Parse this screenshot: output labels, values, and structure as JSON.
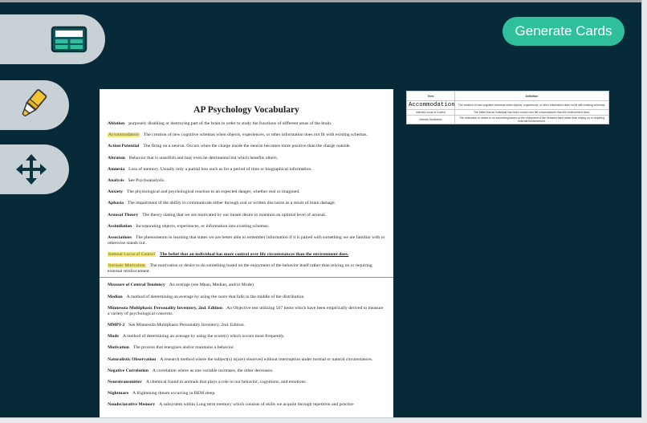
{
  "toolbar": {
    "tools": [
      {
        "name": "table-view",
        "icon": "table-icon"
      },
      {
        "name": "highlighter",
        "icon": "highlighter-icon"
      },
      {
        "name": "move",
        "icon": "move-arrows-icon"
      }
    ]
  },
  "generate_button_label": "Generate Cards",
  "document": {
    "title": "AP Psychology Vocabulary",
    "entries": [
      {
        "term": "Ablation",
        "def": "purposely disabling or destroying part of the brain in order to study the functions of different areas of the brain."
      },
      {
        "term": "Accommodation",
        "def": "The creation of new cognitive schemas when objects, experiences, or other information does not fit with existing schemas.",
        "highlight": true
      },
      {
        "term": "Action Potential",
        "def": "The firing on a neuron.  Occurs when the charge inside the neuron becomes more positive than the charge outside."
      },
      {
        "term": "Altruism",
        "def": "Behavior that is unselfish and may even be detrimental but which benefits others."
      },
      {
        "term": "Amnesia",
        "def": "Loss of memory.  Usually only a partial loss such as for a period of time or biographical information."
      },
      {
        "term": "Analysis",
        "def": "See Psychoanalysis."
      },
      {
        "term": "Anxiety",
        "def": "The physiological and psychological reaction to an expected danger, whether real or imagined."
      },
      {
        "term": "Aphasia",
        "def": "The impairment of the ability to communicate either through oral or written discourse as a result of brain damage."
      },
      {
        "term": "Arousal Theory",
        "def": "The theory stating that we are motivated by our innate desire to maintain an optimal level of arousal."
      },
      {
        "term": "Assimilation",
        "def": "Incorporating objects, experiences, or information into existing schemas."
      },
      {
        "term": "Associations",
        "def": "The phenomenon in learning that states we are better able to remember information if it is paired with something we are familiar with or otherwise stands out."
      },
      {
        "term": "Internal Locus of Control",
        "def": "The belief that an individual has more control over life circumstances than the environment does.",
        "highlight": true,
        "underline": true
      },
      {
        "term": "Intrinsic Motivation",
        "def": "The motivation or desire to do something based on the enjoyment of the behavior itself rather than relying on or requiring external reinforcement.",
        "highlight": true,
        "separator_after": true
      },
      {
        "term": "Measure of Central Tendency",
        "def": "An average (see Mean, Median, and/or Mode)"
      },
      {
        "term": "Median",
        "def": "A method of determining an average by using the score that falls in the middle of the distribution."
      },
      {
        "term": "Minnesota Multiphasic Personality Inventory, 2nd. Edition",
        "def": "An Objective test utilizing 567 items which have been empirically derived to measure a variety of psychological concerns."
      },
      {
        "term": "MMPI-2",
        "def": "See Minnesota Multiphasic Personality Inventory, 2nd. Edition."
      },
      {
        "term": "Mode",
        "def": "A method of determining an average by using the score(s) which occurs most frequently."
      },
      {
        "term": "Motivation",
        "def": "The process that energizes and/or maintains a behavior."
      },
      {
        "term": "Naturalistic Observation",
        "def": "A research method where the subject(s) is(are) observed without interruption under normal or natural circumstances."
      },
      {
        "term": "Negative Correlation",
        "def": "A correlation where as one variable increases, the other decreases."
      },
      {
        "term": "Neurotransmitter",
        "def": "A chemical found in animals that plays a role in our behavior, cognitions, and emotions."
      },
      {
        "term": "Nightmare",
        "def": "A frightening dream occurring in REM sleep."
      },
      {
        "term": "Nondeclarative Memory",
        "def": "A subsystem within Long term memory which consists of skills we acquire through repetition and practice"
      }
    ]
  },
  "cards": {
    "headers": {
      "term": "Term",
      "definition": "Definition"
    },
    "rows": [
      {
        "term": "Accommodation",
        "definition": "The creation of new cognitive schemas when objects, experiences, or other information does not fit with existing schemas.",
        "mono": true
      },
      {
        "term": "Internal Locus of Control",
        "definition": "The belief that an individual has more control over life circumstances than the environment does."
      },
      {
        "term": "Intrinsic Motivation",
        "definition": "The motivation or desire to do something based on the enjoyment of the behavior itself rather than relying on or requiring external reinforcement."
      }
    ]
  },
  "colors": {
    "background": "#062a38",
    "tool_button": "#c8d1d6",
    "accent": "#2fc09b",
    "highlight": "#f4ea7a"
  }
}
